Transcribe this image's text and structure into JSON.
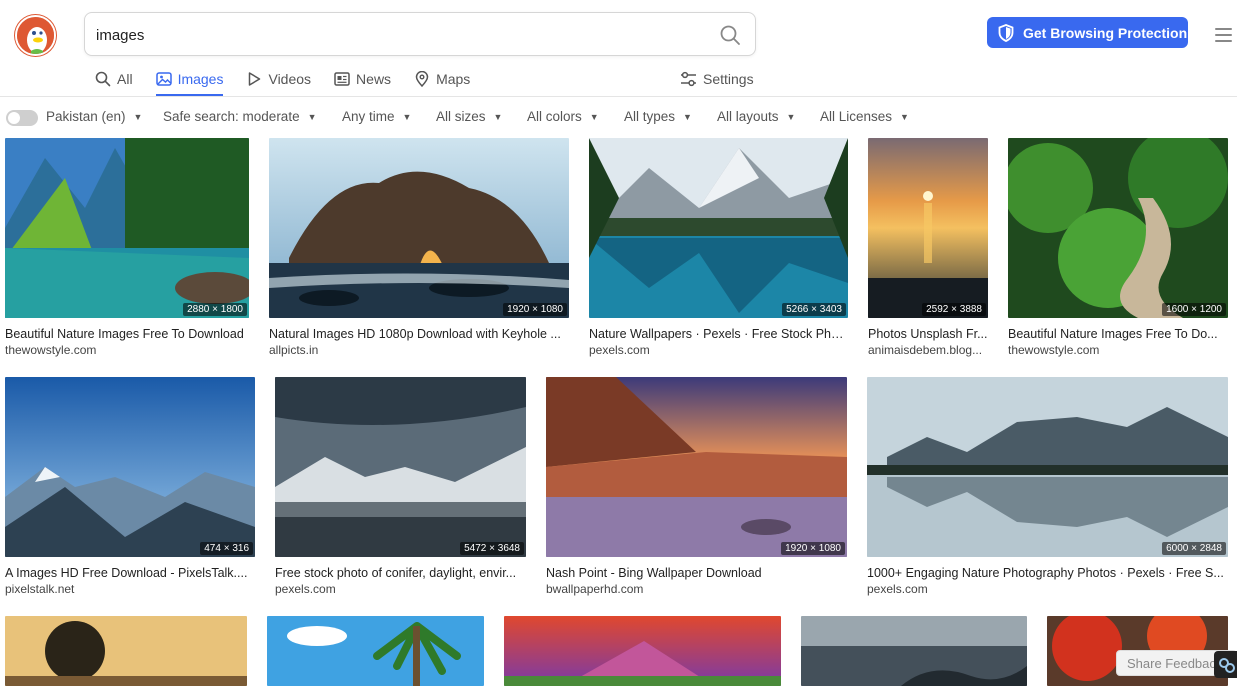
{
  "search": {
    "query": "images",
    "placeholder": ""
  },
  "header": {
    "cta_label": "Get Browsing Protection"
  },
  "tabs": [
    {
      "label": "All",
      "icon": "search-icon"
    },
    {
      "label": "Images",
      "icon": "image-icon",
      "active": true
    },
    {
      "label": "Videos",
      "icon": "play-icon"
    },
    {
      "label": "News",
      "icon": "news-icon"
    },
    {
      "label": "Maps",
      "icon": "map-pin-icon"
    }
  ],
  "settings_label": "Settings",
  "filters": {
    "region": "Pakistan (en)",
    "safe_search": "Safe search: moderate",
    "time": "Any time",
    "size": "All sizes",
    "color": "All colors",
    "type": "All types",
    "layout": "All layouts",
    "license": "All Licenses"
  },
  "results": [
    {
      "title": "Beautiful Nature Images Free To Download",
      "source": "thewowstyle.com",
      "dimensions": "2880 × 1800"
    },
    {
      "title": "Natural Images HD 1080p Download with Keyhole ...",
      "source": "allpicts.in",
      "dimensions": "1920 × 1080"
    },
    {
      "title": "Nature Wallpapers · Pexels · Free Stock Pho...",
      "source": "pexels.com",
      "dimensions": "5266 × 3403"
    },
    {
      "title": "Photos Unsplash Fr...",
      "source": "animaisdebem.blog...",
      "dimensions": "2592 × 3888"
    },
    {
      "title": "Beautiful Nature Images Free To Do...",
      "source": "thewowstyle.com",
      "dimensions": "1600 × 1200"
    },
    {
      "title": "A Images HD Free Download - PixelsTalk....",
      "source": "pixelstalk.net",
      "dimensions": "474 × 316"
    },
    {
      "title": "Free stock photo of conifer, daylight, envir...",
      "source": "pexels.com",
      "dimensions": "5472 × 3648"
    },
    {
      "title": "Nash Point - Bing Wallpaper Download",
      "source": "bwallpaperhd.com",
      "dimensions": "1920 × 1080"
    },
    {
      "title": "1000+ Engaging Nature Photography Photos · Pexels · Free S...",
      "source": "pexels.com",
      "dimensions": "6000 × 2848"
    },
    {
      "title": "",
      "source": "",
      "dimensions": ""
    },
    {
      "title": "",
      "source": "",
      "dimensions": ""
    },
    {
      "title": "",
      "source": "",
      "dimensions": ""
    },
    {
      "title": "",
      "source": "",
      "dimensions": ""
    },
    {
      "title": "",
      "source": "",
      "dimensions": ""
    }
  ],
  "feedback_label": "Share Feedback",
  "colors": {
    "accent": "#3969ef",
    "logo": "#de5833"
  }
}
